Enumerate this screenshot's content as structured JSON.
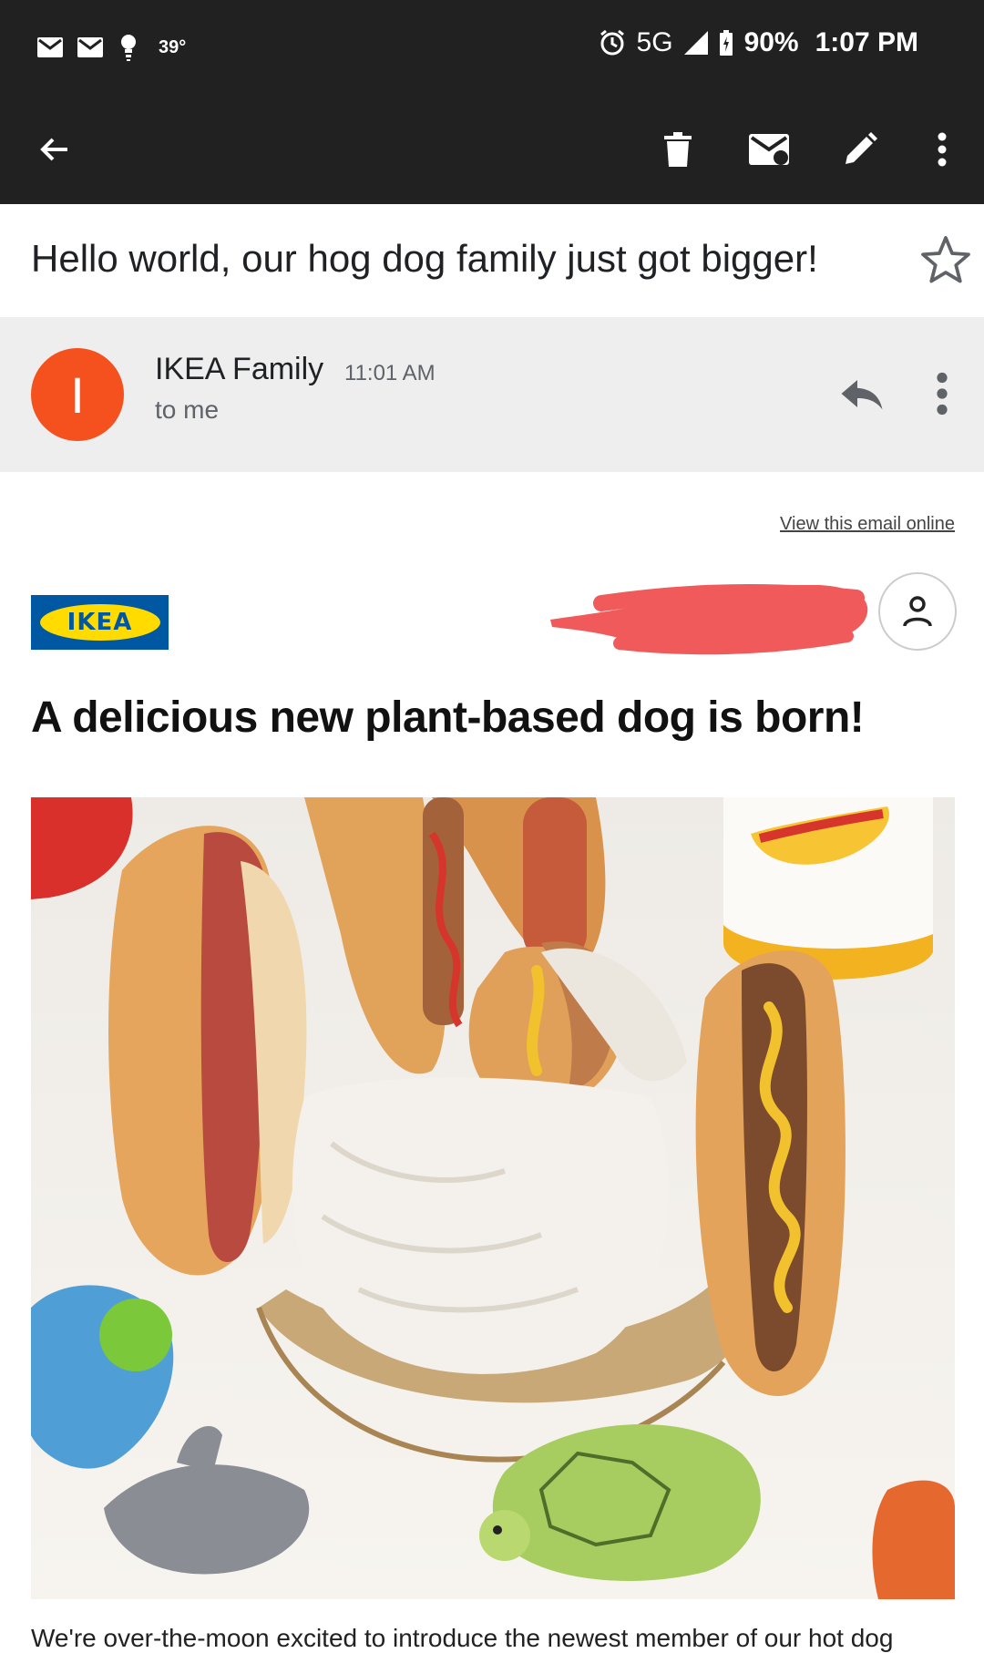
{
  "status_bar": {
    "temperature": "39°",
    "network": "5G",
    "battery": "90%",
    "time": "1:07 PM"
  },
  "toolbar": {
    "icons": [
      "back-arrow-icon",
      "trash-icon",
      "mark-unread-icon",
      "edit-icon",
      "more-vert-icon"
    ]
  },
  "email": {
    "subject": "Hello world, our hog dog family just got bigger!",
    "sender_initial": "I",
    "sender_name": "IKEA Family",
    "sent_time": "11:01 AM",
    "recipient_line": "to me"
  },
  "content": {
    "view_online_link": "View this email online",
    "logo_text": "IKEA",
    "headline": "A delicious new plant-based dog is born!",
    "body_start": "We're over-the-moon excited to introduce the newest member of our hot dog"
  },
  "colors": {
    "status_bg": "#212121",
    "avatar": "#f4511e",
    "ikea_blue": "#0058a3",
    "ikea_yellow": "#ffdb00",
    "redaction": "#f05a5a"
  }
}
